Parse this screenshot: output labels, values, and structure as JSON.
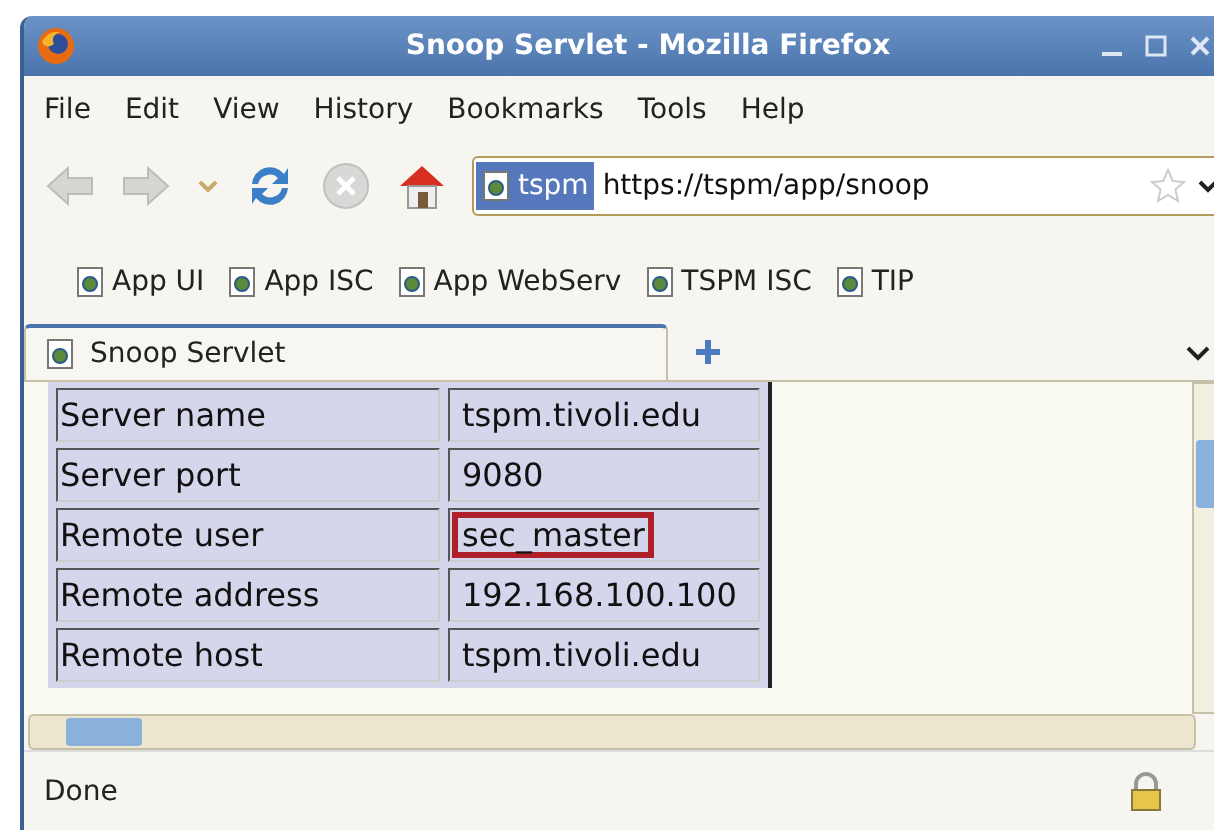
{
  "window": {
    "title": "Snoop Servlet - Mozilla Firefox"
  },
  "menu": [
    "File",
    "Edit",
    "View",
    "History",
    "Bookmarks",
    "Tools",
    "Help"
  ],
  "address": {
    "site": "tspm",
    "url": "https://tspm/app/snoop"
  },
  "bookmarks": [
    "App UI",
    "App ISC",
    "App WebServ",
    "TSPM ISC",
    "TIP"
  ],
  "tabs": [
    {
      "label": "Snoop Servlet",
      "selected": true
    }
  ],
  "table": {
    "rows": [
      {
        "label": "Server name",
        "value": "tspm.tivoli.edu",
        "highlighted": false
      },
      {
        "label": "Server port",
        "value": "9080",
        "highlighted": false
      },
      {
        "label": "Remote user",
        "value": "sec_master",
        "highlighted": true
      },
      {
        "label": "Remote address",
        "value": "192.168.100.100",
        "highlighted": false
      },
      {
        "label": "Remote host",
        "value": "tspm.tivoli.edu",
        "highlighted": false
      }
    ]
  },
  "status_bar": {
    "text": "Done"
  }
}
